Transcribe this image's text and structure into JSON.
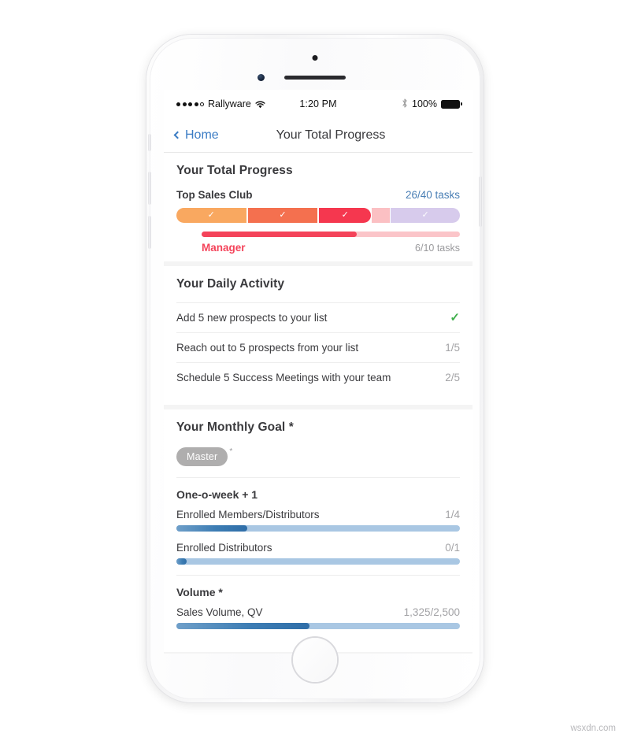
{
  "status_bar": {
    "carrier": "Rallyware",
    "signal_filled_dots": 4,
    "signal_total_dots": 5,
    "wifi_icon": "wifi-icon",
    "time": "1:20 PM",
    "bluetooth_icon": "bluetooth-icon",
    "battery_percent": "100%"
  },
  "nav": {
    "back_label": "Home",
    "back_icon": "chevron-left-icon",
    "title": "Your Total Progress"
  },
  "total_progress": {
    "heading": "Your Total Progress",
    "club_label": "Top Sales Club",
    "club_tasks": "26/40 tasks",
    "segments": [
      {
        "name": "segment-1",
        "color": "#f9a860",
        "completed": true,
        "check": "✓"
      },
      {
        "name": "segment-2",
        "color": "#f4704f",
        "completed": true,
        "check": "✓"
      },
      {
        "name": "segment-3",
        "color": "#f5374f",
        "completed": true,
        "check": "✓"
      },
      {
        "name": "segment-gap",
        "color": "#fbc0c3",
        "completed": false,
        "check": ""
      },
      {
        "name": "segment-4",
        "color": "#d7cbec",
        "completed": true,
        "check": "✓"
      }
    ],
    "tier_name": "Manager",
    "tier_tasks": "6/10 tasks",
    "tier_percent": 60,
    "tier_fill_color": "#f4435a",
    "tier_track_color": "#fbc5c9"
  },
  "daily_activity": {
    "heading": "Your Daily Activity",
    "items": [
      {
        "label": "Add 5 new prospects to your list",
        "value": "",
        "done": true,
        "check": "✓"
      },
      {
        "label": "Reach out to 5 prospects from your list",
        "value": "1/5",
        "done": false,
        "check": ""
      },
      {
        "label": "Schedule 5 Success Meetings with your team",
        "value": "2/5",
        "done": false,
        "check": ""
      }
    ],
    "check_color": "#3faf4b"
  },
  "monthly_goal": {
    "heading": "Your Monthly Goal *",
    "badge_label": "Master",
    "badge_asterisk": "*",
    "badge_color": "#abaaaa",
    "groups": [
      {
        "title": "One-o-week + 1",
        "metrics": [
          {
            "label": "Enrolled Members/Distributors",
            "value": "1/4",
            "percent": 25
          },
          {
            "label": "Enrolled Distributors",
            "value": "0/1",
            "percent": 2
          }
        ]
      },
      {
        "title": "Volume *",
        "metrics": [
          {
            "label": "Sales Volume, QV",
            "value": "1,325/2,500",
            "percent": 47
          }
        ]
      }
    ],
    "bar_fill_color": "#3d7db4",
    "bar_track_color": "#a9c7e3"
  },
  "watermark": "wsxdn.com"
}
